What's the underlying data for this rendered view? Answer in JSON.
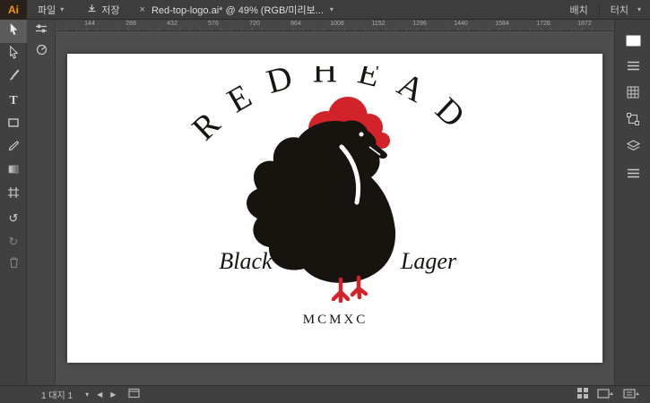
{
  "topbar": {
    "app_logo": "Ai",
    "file_menu": "파일",
    "save_label": "저장",
    "doc_title": "Red-top-logo.ai* @ 49% (RGB/미리보...",
    "workspace_arrange": "배치",
    "workspace_name": "터치"
  },
  "icons": {
    "dropdown": "▾",
    "close": "×",
    "prev": "◀",
    "next": "▶",
    "undo": "↺",
    "redo": "↻",
    "type_tool": "T"
  },
  "ruler": {
    "ticks": [
      "144",
      "288",
      "432",
      "576",
      "720",
      "864",
      "1008",
      "1152",
      "1296",
      "1440",
      "1584",
      "1728",
      "1872"
    ]
  },
  "artboard_logo": {
    "title": "REDHEAD",
    "word_left": "Black",
    "word_right": "Lager",
    "year": "MCMXC",
    "accent_red": "#d2232a",
    "ink_black": "#17130f"
  },
  "statusbar": {
    "artboard_label": "1 대지 1"
  }
}
